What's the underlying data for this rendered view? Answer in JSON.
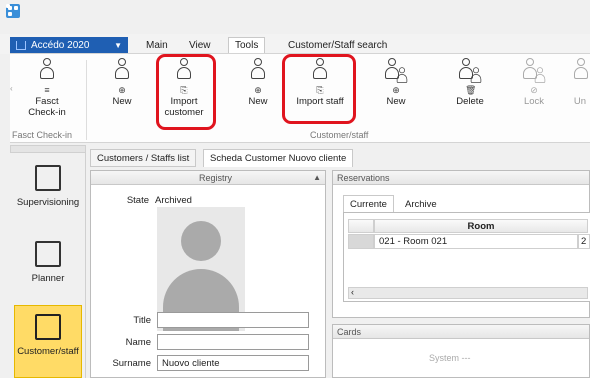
{
  "app": {
    "menu_label": "Accédo 2020"
  },
  "tabs": [
    {
      "label": "Main"
    },
    {
      "label": "View"
    },
    {
      "label": "Tools"
    },
    {
      "label": "Customer/Staff search"
    }
  ],
  "ribbon": {
    "buttons": [
      {
        "label_line1": "Fasct",
        "label_line2": "Check-in",
        "badge": "≡"
      },
      {
        "label_line1": "New",
        "label_line2": "",
        "badge": "⊕"
      },
      {
        "label_line1": "Import",
        "label_line2": "customer",
        "badge": "⎘"
      },
      {
        "label_line1": "New",
        "label_line2": "",
        "badge": "⊕"
      },
      {
        "label_line1": "Import staff",
        "label_line2": "",
        "badge": "⎘"
      },
      {
        "label_line1": "New",
        "label_line2": "",
        "badge": "⊕"
      },
      {
        "label_line1": "Delete",
        "label_line2": "",
        "badge": "🗑"
      },
      {
        "label_line1": "Lock",
        "label_line2": "",
        "badge": "⊘"
      },
      {
        "label_line1": "Un",
        "label_line2": "",
        "badge": ""
      }
    ],
    "groups": [
      {
        "label": "Fasct Check-in"
      },
      {
        "label": "Customer/staff"
      }
    ]
  },
  "nav": {
    "items": [
      {
        "label": "Supervisioning",
        "icon": "monitor-icon"
      },
      {
        "label": "Planner",
        "icon": "planner-icon"
      },
      {
        "label": "Customer/staff",
        "icon": "door-exit-icon"
      }
    ]
  },
  "doc_tabs": [
    {
      "label": "Customers / Staffs list"
    },
    {
      "label": "Scheda Customer Nuovo cliente"
    }
  ],
  "registry": {
    "title": "Registry",
    "state_label": "State",
    "state_value": "Archived",
    "fields": [
      {
        "label": "Title",
        "value": ""
      },
      {
        "label": "Name",
        "value": ""
      },
      {
        "label": "Surname",
        "value": "Nuovo cliente"
      }
    ]
  },
  "reservations": {
    "title": "Reservations",
    "tabs": [
      {
        "label": "Currente"
      },
      {
        "label": "Archive"
      }
    ],
    "columns": [
      "Room"
    ],
    "rows": [
      {
        "room": "021 - Room 021",
        "extra": "2"
      }
    ]
  },
  "cards": {
    "title": "Cards",
    "system_label": "System ---"
  },
  "colors": {
    "accent": "#1f5fb3",
    "highlight": "#e0141e",
    "active_nav": "#ffdb66"
  }
}
